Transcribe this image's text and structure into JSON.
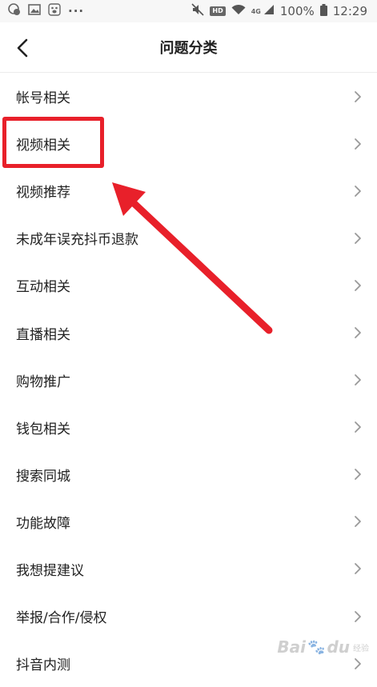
{
  "status_bar": {
    "left_icons": [
      "chat-notification-icon",
      "image-notification-icon",
      "baidu-paw-icon",
      "more-dots-icon"
    ],
    "more": "···",
    "hd": "HD",
    "signal_type": "4G",
    "battery_percent": "100%",
    "time": "12:29"
  },
  "header": {
    "title": "问题分类",
    "back_icon": "chevron-left-icon"
  },
  "items": [
    {
      "label": "帐号相关"
    },
    {
      "label": "视频相关"
    },
    {
      "label": "视频推荐"
    },
    {
      "label": "未成年误充抖币退款"
    },
    {
      "label": "互动相关"
    },
    {
      "label": "直播相关"
    },
    {
      "label": "购物推广"
    },
    {
      "label": "钱包相关"
    },
    {
      "label": "搜索同城"
    },
    {
      "label": "功能故障"
    },
    {
      "label": "我想提建议"
    },
    {
      "label": "举报/合作/侵权"
    },
    {
      "label": "抖音内测"
    }
  ],
  "annotation": {
    "highlighted_item": "视频相关",
    "color": "#e8202a"
  },
  "watermark": {
    "text": "Bai",
    "text2": "du",
    "sub": "经验"
  }
}
